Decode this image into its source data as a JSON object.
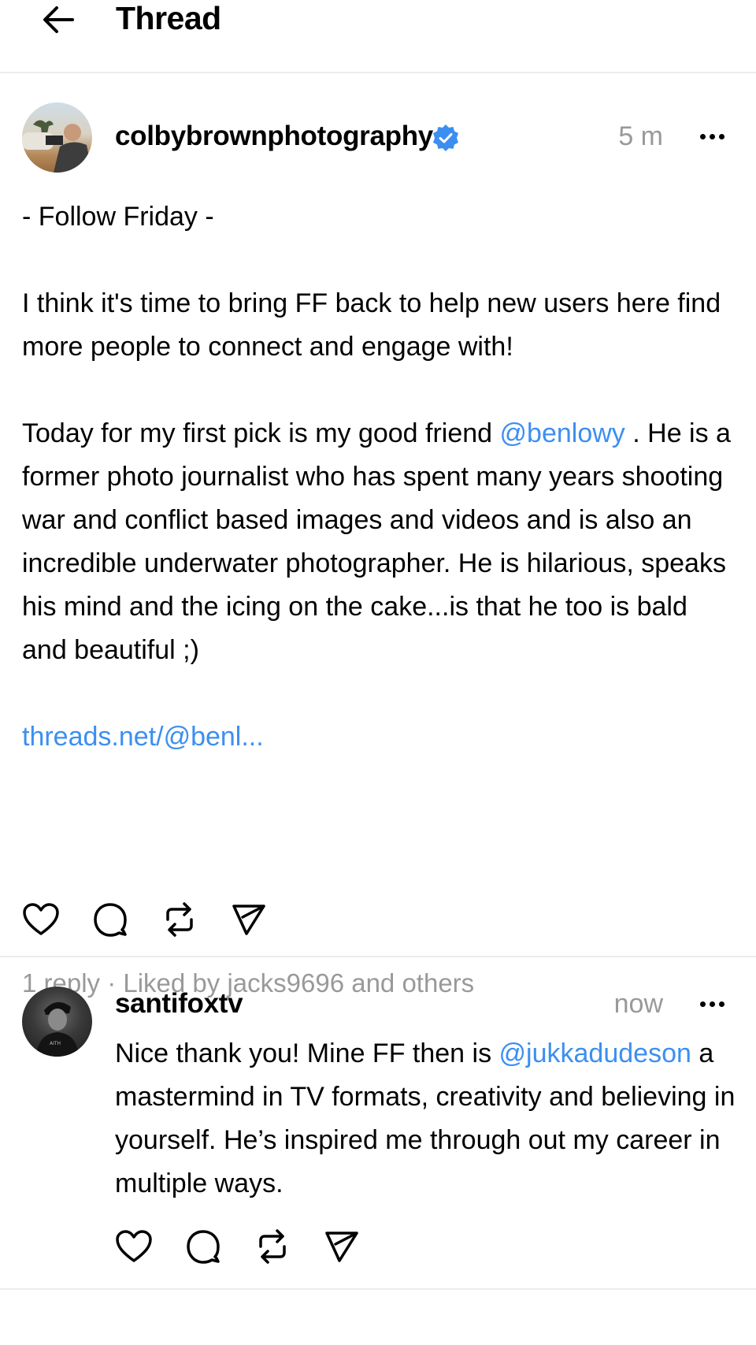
{
  "header": {
    "back_icon": "arrow-left-icon",
    "title": "Thread"
  },
  "main_post": {
    "username": "colbybrownphotography",
    "verified": true,
    "timestamp": "5 m",
    "more_icon": "more-horizontal-icon",
    "paragraphs": {
      "p1": "- Follow Friday -",
      "p2": "I think it's time to bring FF back to help new users here find more people to connect and engage with!",
      "p3_before": "Today for my first pick is my good friend ",
      "p3_mention": "@benlowy",
      "p3_after": " . He is a former photo journalist who has spent many years shooting war and conflict based images and videos and is also an incredible underwater photographer. He is hilarious, speaks his mind and the icing on the cake...is that he too is bald and beautiful ;)",
      "link": "threads.net/@benl..."
    },
    "actions": [
      "heart-icon",
      "comment-icon",
      "repost-icon",
      "share-icon"
    ],
    "stats": "1 reply · Liked by jacks9696 and others"
  },
  "reply": {
    "username": "santifoxtv",
    "timestamp": "now",
    "more_icon": "more-horizontal-icon",
    "text_before": "Nice thank you! Mine FF then is ",
    "mention": "@jukkadudeson",
    "text_after": " a mastermind in TV formats, creativity and believing in yourself. He’s inspired me through out my career in multiple ways.",
    "actions": [
      "heart-icon",
      "comment-icon",
      "repost-icon",
      "share-icon"
    ]
  },
  "colors": {
    "link": "#3c8ff0",
    "verified_badge": "#3c8ff0",
    "muted_text": "#999999",
    "divider": "#ececec"
  }
}
